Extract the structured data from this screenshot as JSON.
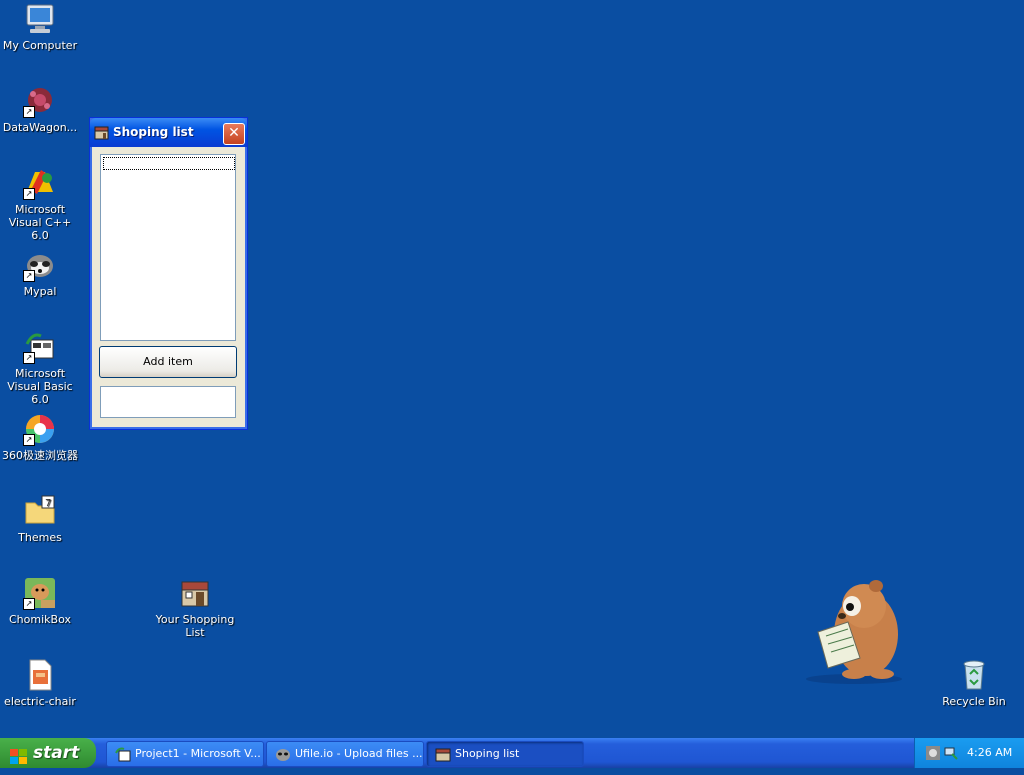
{
  "desktop": {
    "icons": [
      {
        "label": "My Computer"
      },
      {
        "label": "DataWagon..."
      },
      {
        "label": "Microsoft Visual C++ 6.0"
      },
      {
        "label": "Mypal"
      },
      {
        "label": "Microsoft Visual Basic 6.0"
      },
      {
        "label": "360极速浏览器"
      },
      {
        "label": "Themes"
      },
      {
        "label": "ChomikBox"
      },
      {
        "label": "electric-chair"
      },
      {
        "label": "Your Shopping List"
      },
      {
        "label": "Recycle Bin"
      }
    ],
    "shortcut_arrow": "↗"
  },
  "window": {
    "title": "Shoping list",
    "close_glyph": "✕",
    "add_button_label": "Add item",
    "list_items": [],
    "input_value": ""
  },
  "taskbar": {
    "start_label": "start",
    "tasks": [
      {
        "label": "Project1 - Microsoft V..."
      },
      {
        "label": "Ufile.io - Upload files ..."
      },
      {
        "label": "Shoping list"
      }
    ],
    "clock": "4:26 AM"
  },
  "colors": {
    "desktop": "#0a4ea2",
    "titlebar": "#0054e3",
    "close": "#c4421f",
    "start": "#3c9e3d"
  }
}
